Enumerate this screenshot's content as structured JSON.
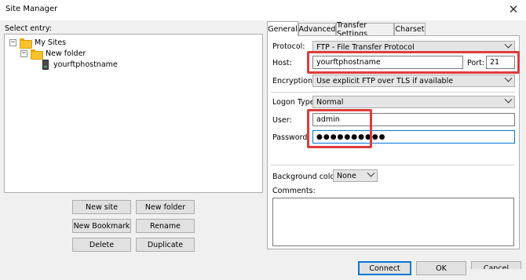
{
  "window": {
    "title": "Site Manager",
    "close_glyph": "✕"
  },
  "tree": {
    "label": "Select entry:",
    "root": {
      "label": "My Sites",
      "expander": "−"
    },
    "folder": {
      "label": "New folder",
      "expander": "−"
    },
    "site": {
      "label": "yourftphostname"
    }
  },
  "left_buttons": {
    "new_site": "New site",
    "new_folder": "New folder",
    "new_bookmark": "New Bookmark",
    "rename": "Rename",
    "delete": "Delete",
    "duplicate": "Duplicate"
  },
  "tabs": [
    "General",
    "Advanced",
    "Transfer Settings",
    "Charset"
  ],
  "general": {
    "protocol_label": "Protocol:",
    "protocol_value": "FTP - File Transfer Protocol",
    "host_label": "Host:",
    "host_value": "yourftphostname",
    "port_label": "Port:",
    "port_value": "21",
    "encryption_label": "Encryption:",
    "encryption_value": "Use explicit FTP over TLS if available",
    "logon_label": "Logon Type:",
    "logon_value": "Normal",
    "user_label": "User:",
    "user_value": "admin",
    "password_label": "Password:",
    "password_mask": "●●●●●●●●●●",
    "bg_color_label": "Background color:",
    "bg_color_value": "None",
    "comments_label": "Comments:",
    "comments_value": ""
  },
  "bottom_buttons": {
    "connect": "Connect",
    "ok": "OK",
    "cancel": "Cancel"
  },
  "highlight_color": "#e03c3c"
}
